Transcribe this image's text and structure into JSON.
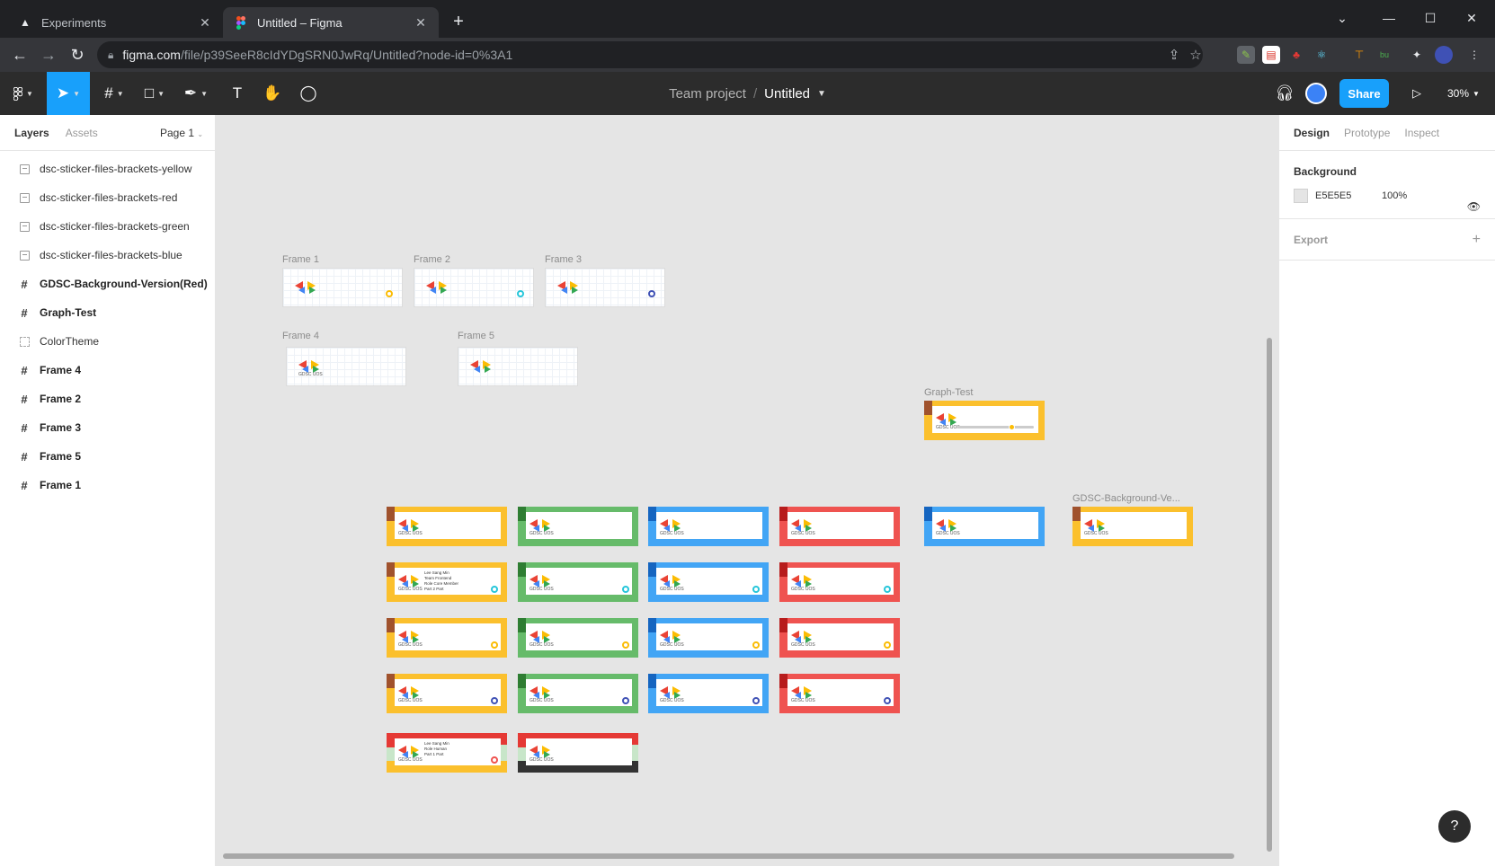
{
  "browser": {
    "tabs": [
      {
        "label": "Experiments",
        "icon": "flask-icon",
        "active": false
      },
      {
        "label": "Untitled – Figma",
        "icon": "figma-icon",
        "active": true
      }
    ],
    "url_host": "figma.com",
    "url_path": "/file/p39SeeR8cIdYDgSRN0JwRq/Untitled?node-id=0%3A1"
  },
  "figma_toolbar": {
    "project": "Team project",
    "file_name": "Untitled",
    "share_label": "Share",
    "zoom": "30%"
  },
  "left_panel": {
    "tabs": [
      "Layers",
      "Assets"
    ],
    "page": "Page 1",
    "layers": [
      {
        "name": "dsc-sticker-files-brackets-yellow",
        "kind": "image"
      },
      {
        "name": "dsc-sticker-files-brackets-red",
        "kind": "image"
      },
      {
        "name": "dsc-sticker-files-brackets-green",
        "kind": "image"
      },
      {
        "name": "dsc-sticker-files-brackets-blue",
        "kind": "image"
      },
      {
        "name": "GDSC-Background-Version(Red)",
        "kind": "frame"
      },
      {
        "name": "Graph-Test",
        "kind": "frame"
      },
      {
        "name": "ColorTheme",
        "kind": "section"
      },
      {
        "name": "Frame 4",
        "kind": "frame"
      },
      {
        "name": "Frame 2",
        "kind": "frame"
      },
      {
        "name": "Frame 3",
        "kind": "frame"
      },
      {
        "name": "Frame 5",
        "kind": "frame"
      },
      {
        "name": "Frame 1",
        "kind": "frame"
      }
    ]
  },
  "canvas": {
    "frame_labels": {
      "frame1": "Frame 1",
      "frame2": "Frame 2",
      "frame3": "Frame 3",
      "frame4": "Frame 4",
      "frame5": "Frame 5",
      "graph_test": "Graph-Test",
      "gdsc_bg": "GDSC-Background-Ve..."
    },
    "sticker_text": "GDSC UOS",
    "info_lines_1": [
      "Lee Sang Min",
      "Team   Frontend",
      "Role   Core Member",
      "Part   2 Part"
    ],
    "info_lines_2": [
      "Lee Sang Min",
      "Role   Human",
      "Part   1 Part"
    ],
    "colors": {
      "yellow": "#fbc02d",
      "green": "#66bb6a",
      "blue": "#42a5f5",
      "red": "#ef5350"
    }
  },
  "right_panel": {
    "tabs": [
      "Design",
      "Prototype",
      "Inspect"
    ],
    "background_title": "Background",
    "background_hex": "E5E5E5",
    "background_opacity": "100%",
    "export_title": "Export"
  }
}
